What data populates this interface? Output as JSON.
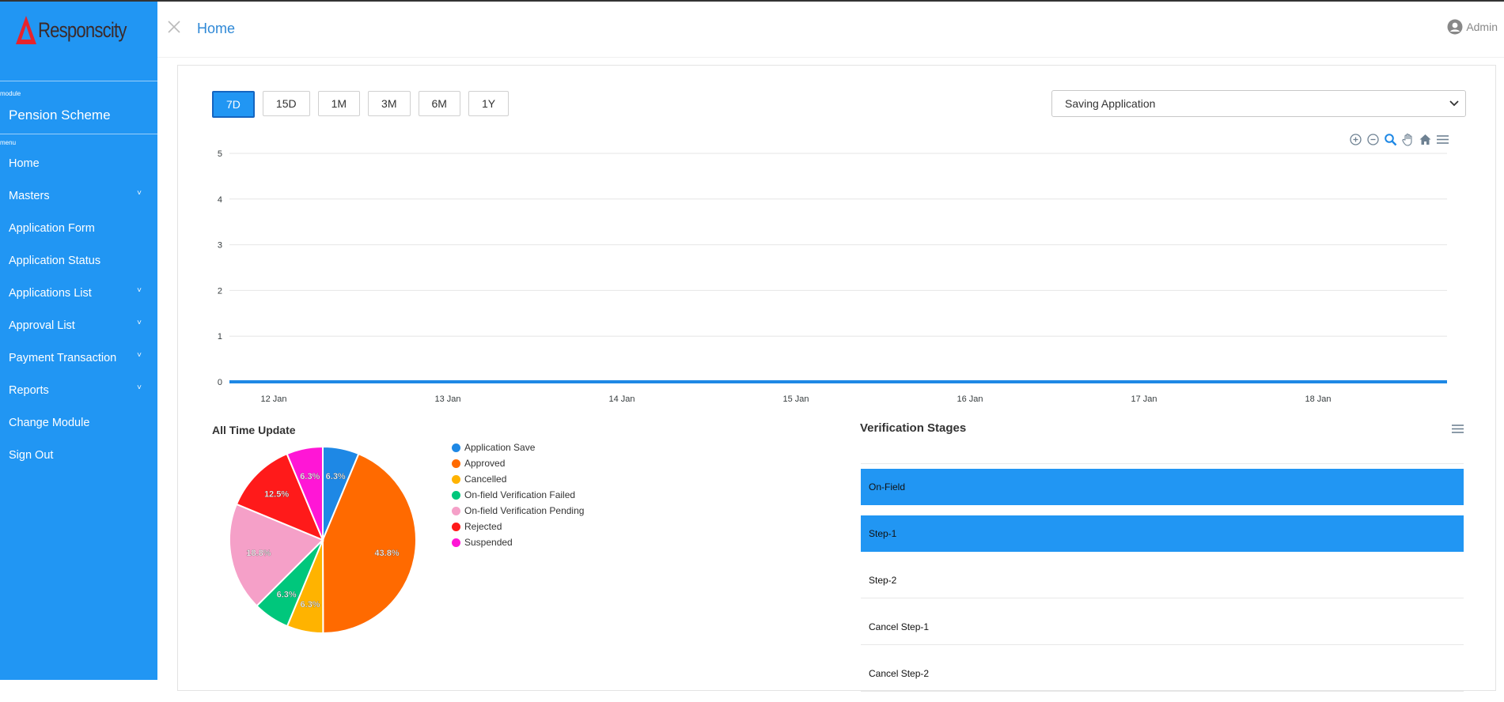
{
  "brand": {
    "logo_text": "Responscity"
  },
  "sidebar": {
    "module_caption": "module",
    "module_name": "Pension Scheme",
    "menu_caption": "menu",
    "items": [
      {
        "label": "Home",
        "has_children": false
      },
      {
        "label": "Masters",
        "has_children": true
      },
      {
        "label": "Application Form",
        "has_children": false
      },
      {
        "label": "Application Status",
        "has_children": false
      },
      {
        "label": "Applications List",
        "has_children": true
      },
      {
        "label": "Approval List",
        "has_children": true
      },
      {
        "label": "Payment Transaction",
        "has_children": true
      },
      {
        "label": "Reports",
        "has_children": true
      },
      {
        "label": "Change Module",
        "has_children": false
      },
      {
        "label": "Sign Out",
        "has_children": false
      }
    ],
    "chevron": "˅"
  },
  "header": {
    "title": "Home",
    "user": "Admin"
  },
  "range_buttons": [
    {
      "label": "7D",
      "active": true
    },
    {
      "label": "15D",
      "active": false
    },
    {
      "label": "1M",
      "active": false
    },
    {
      "label": "3M",
      "active": false
    },
    {
      "label": "6M",
      "active": false
    },
    {
      "label": "1Y",
      "active": false
    }
  ],
  "application_select": {
    "value": "Saving Application"
  },
  "chart_toolbar": [
    "zoom-in-icon",
    "zoom-out-icon",
    "selection-zoom-icon",
    "pan-icon",
    "reset-home-icon",
    "menu-icon"
  ],
  "chart_data": [
    {
      "type": "line",
      "x": [
        "12 Jan",
        "13 Jan",
        "14 Jan",
        "15 Jan",
        "16 Jan",
        "17 Jan",
        "18 Jan"
      ],
      "series": [
        {
          "values": [
            0,
            0,
            0,
            0,
            0,
            0,
            0
          ],
          "color": "#1e88e5"
        }
      ],
      "ylim": [
        0,
        5
      ],
      "yticks": [
        "0",
        "1",
        "2",
        "3",
        "4",
        "5"
      ],
      "grid": true
    },
    {
      "type": "pie",
      "title": "All Time Update",
      "legend": "right",
      "slices": [
        {
          "label": "Application Save",
          "value": 6.3,
          "display": "6.3%",
          "color": "#1e88e5"
        },
        {
          "label": "Approved",
          "value": 43.8,
          "display": "43.8%",
          "color": "#ff6a00"
        },
        {
          "label": "Cancelled",
          "value": 6.3,
          "display": "6.3%",
          "color": "#ffb300"
        },
        {
          "label": "On-field Verification Failed",
          "value": 6.3,
          "display": "6.3%",
          "color": "#00c77c"
        },
        {
          "label": "On-field Verification Pending",
          "value": 18.8,
          "display": "18.8%",
          "color": "#f5a0c8"
        },
        {
          "label": "Rejected",
          "value": 12.5,
          "display": "12.5%",
          "color": "#ff1a1a"
        },
        {
          "label": "Suspended",
          "value": 6.3,
          "display": "6.3%",
          "color": "#ff16d6"
        }
      ]
    }
  ],
  "verification": {
    "title": "Verification Stages",
    "stages": [
      {
        "label": "On-Field",
        "active": true
      },
      {
        "label": "Step-1",
        "active": true
      },
      {
        "label": "Step-2",
        "active": false
      },
      {
        "label": "Cancel Step-1",
        "active": false
      },
      {
        "label": "Cancel Step-2",
        "active": false
      }
    ]
  },
  "colors": {
    "sidebar": "#2196f3",
    "accent": "#2196f3",
    "title_blue": "#2e88d6"
  }
}
